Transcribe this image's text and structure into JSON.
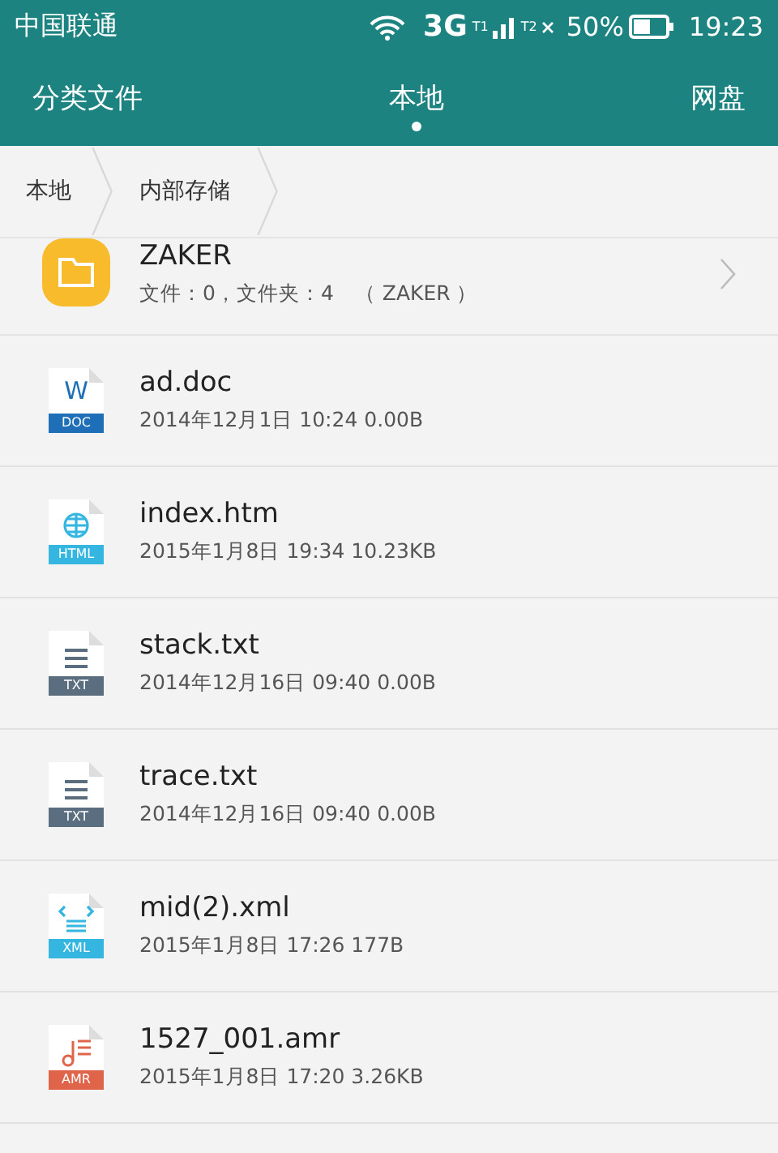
{
  "status_bar": {
    "carrier": "中国联通",
    "network": "3G",
    "sim1": "T1",
    "sim2": "T2",
    "battery": "50%",
    "time": "19:23"
  },
  "tabs": [
    {
      "label": "分类文件",
      "selected": false
    },
    {
      "label": "本地",
      "selected": true
    },
    {
      "label": "网盘",
      "selected": false
    }
  ],
  "breadcrumb": [
    "本地",
    "内部存储"
  ],
  "files": [
    {
      "kind": "folder",
      "name": "ZAKER",
      "meta": "文件：0，文件夹：4　（ ZAKER ）",
      "has_arrow": true
    },
    {
      "kind": "doc",
      "badge": "DOC",
      "glyph": "W",
      "name": "ad.doc",
      "meta": "2014年12月1日 10:24 0.00B"
    },
    {
      "kind": "html",
      "badge": "HTML",
      "name": "index.htm",
      "meta": "2015年1月8日 19:34 10.23KB"
    },
    {
      "kind": "txt",
      "badge": "TXT",
      "name": "stack.txt",
      "meta": "2014年12月16日 09:40 0.00B"
    },
    {
      "kind": "txt",
      "badge": "TXT",
      "name": "trace.txt",
      "meta": "2014年12月16日 09:40 0.00B"
    },
    {
      "kind": "xml",
      "badge": "XML",
      "name": "mid(2).xml",
      "meta": "2015年1月8日 17:26 177B"
    },
    {
      "kind": "amr",
      "badge": "AMR",
      "name": "1527_001.amr",
      "meta": "2015年1月8日 17:20 3.26KB"
    }
  ]
}
